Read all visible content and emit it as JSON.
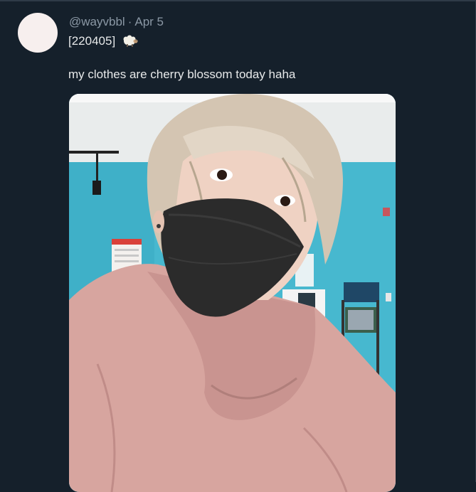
{
  "tweet": {
    "handle": "@wayvbbl",
    "separator": "·",
    "date": "Apr 5",
    "line1": "[220405]",
    "emoji_icon": "sheep-icon",
    "body": "my clothes are cherry blossom today haha"
  },
  "colors": {
    "background": "#15202b",
    "text": "#e7e9ea",
    "muted": "#8b98a5"
  }
}
